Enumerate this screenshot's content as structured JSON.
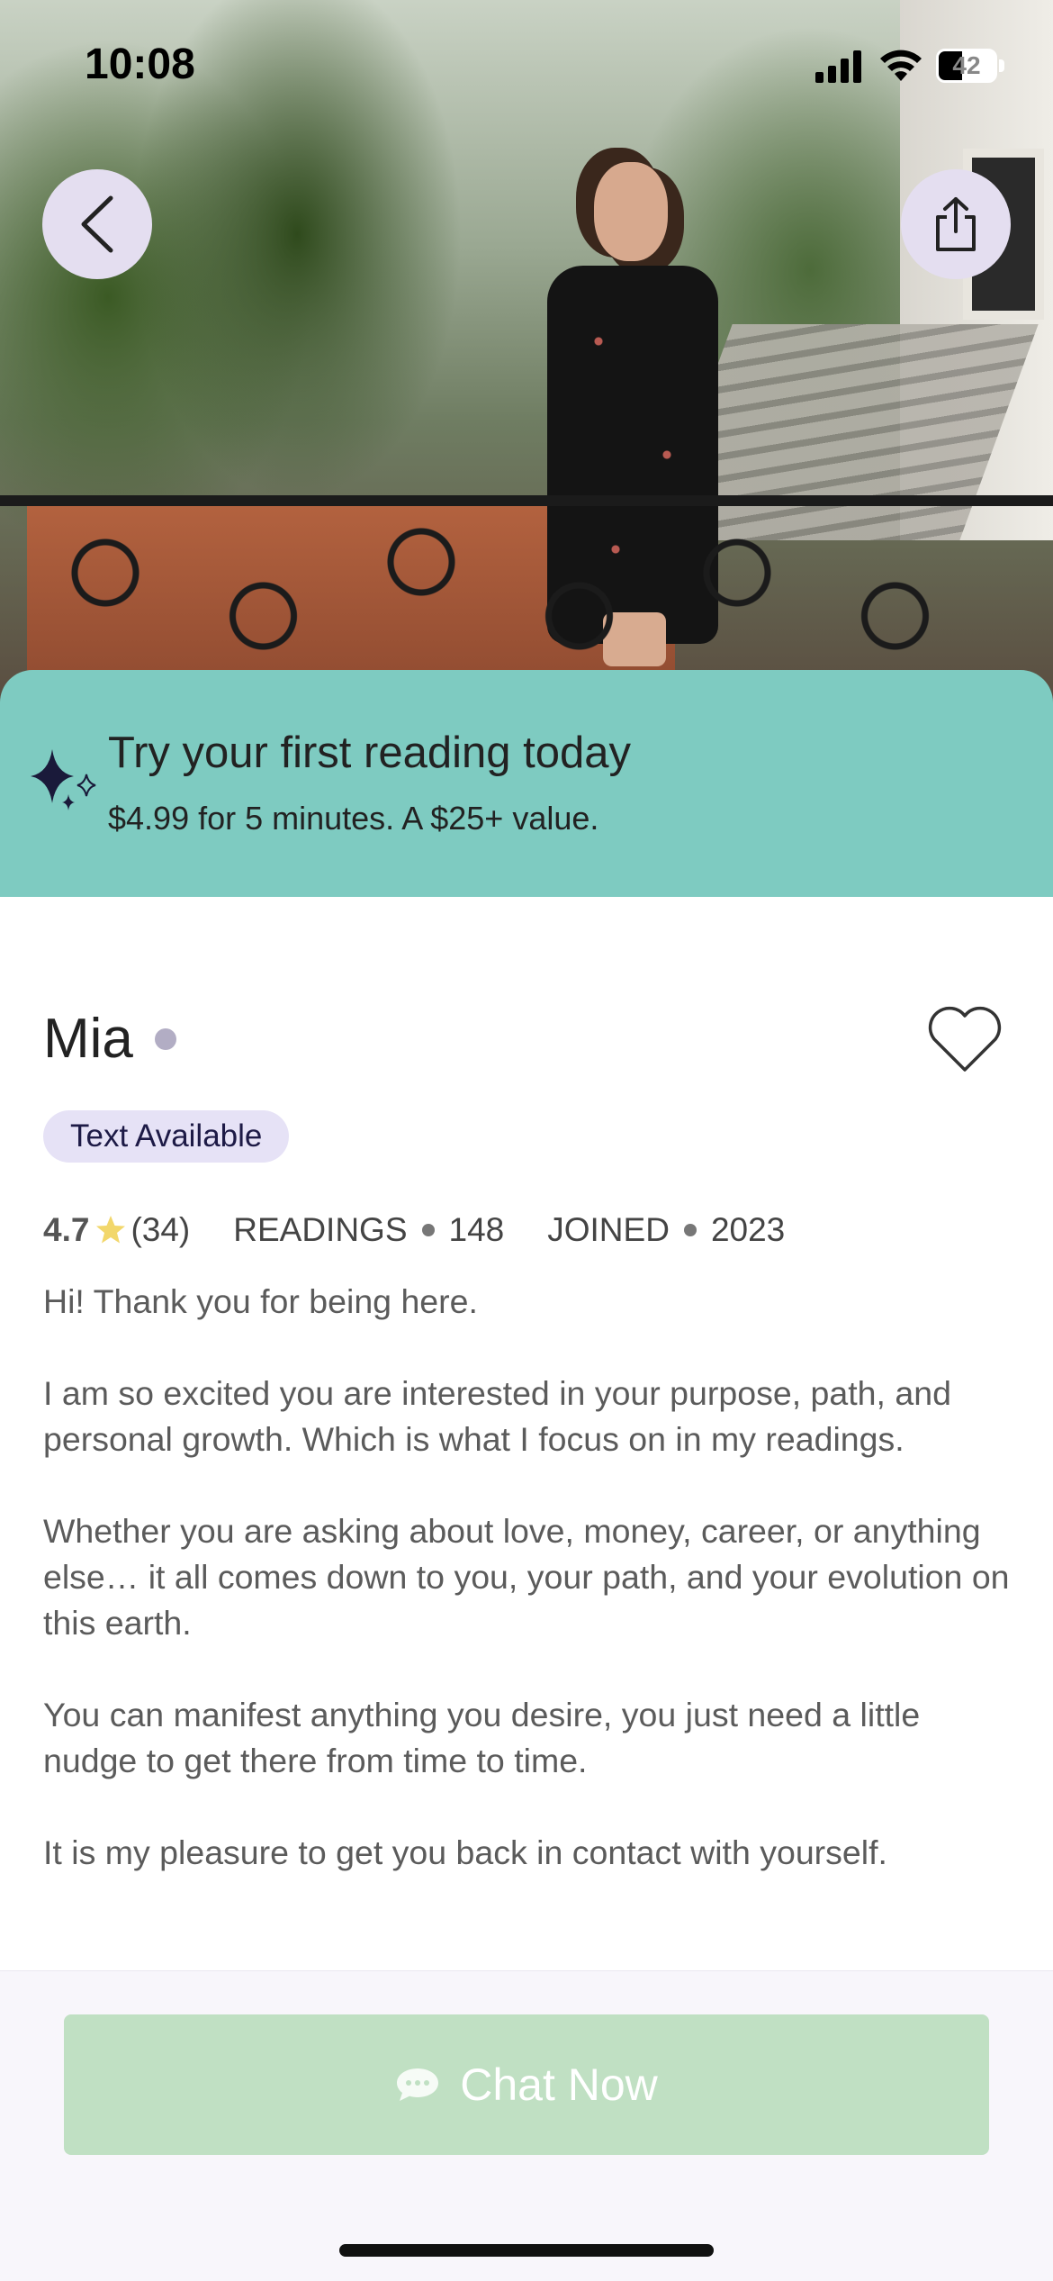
{
  "status_bar": {
    "time": "10:08",
    "battery": "42",
    "battery_level": 0.42
  },
  "header": {
    "back_icon": "chevron-left-icon",
    "share_icon": "share-icon"
  },
  "promo": {
    "icon": "sparkles-icon",
    "title": "Try your first reading today",
    "subtitle": "$4.99 for 5 minutes. A $25+ value."
  },
  "profile": {
    "name": "Mia",
    "status_dot_color": "#b2adc4",
    "badge": "Text Available",
    "rating": "4.7",
    "reviews": "(34)",
    "readings_label": "READINGS",
    "readings_count": "148",
    "joined_label": "JOINED",
    "joined_year": "2023",
    "bio": [
      "Hi! Thank you for being here.",
      "I am so excited you are interested in your purpose, path, and personal growth. Which is what I focus on in my readings.",
      "Whether you are asking about love, money, career, or anything else… it all comes down to you, your path, and your evolution on this earth.",
      "You can manifest anything you desire, you just need a little nudge to get there from time to time.",
      "It is my pleasure to get you back in contact with yourself."
    ]
  },
  "cta": {
    "label": "Chat Now",
    "icon": "chat-bubble-icon",
    "color": "#c0e0c3"
  },
  "colors": {
    "promo_bg": "#7ecbc1",
    "badge_bg": "#e6e2f6",
    "nav_button_bg": "#e4def0",
    "star": "#f2d76b"
  }
}
